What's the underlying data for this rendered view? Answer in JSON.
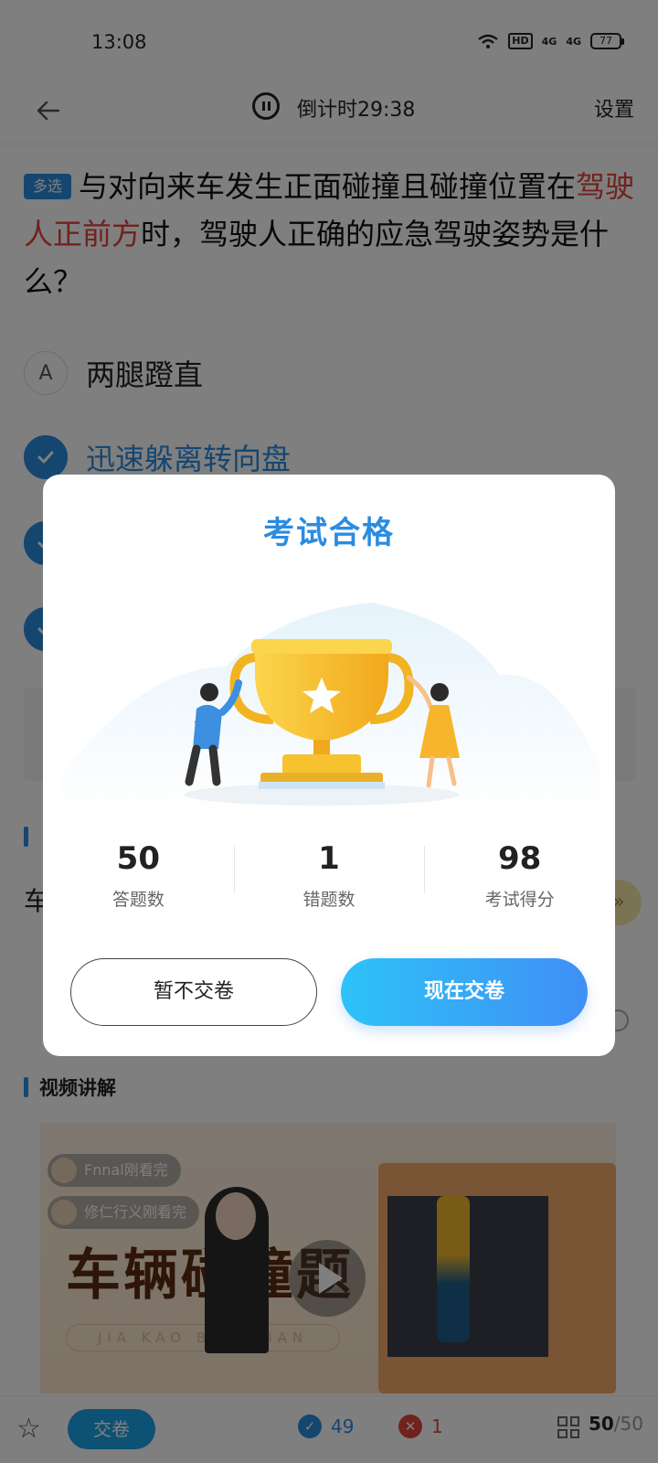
{
  "status_bar": {
    "time": "13:08",
    "network": "HD",
    "signal1": "4G",
    "signal2": "4G",
    "battery": "77"
  },
  "nav": {
    "countdown": "倒计时29:38",
    "settings": "设置"
  },
  "question": {
    "tag": "多选",
    "text_before": "与对向来车发生正面碰撞且碰撞位置在",
    "text_highlight": "驾驶人正前方",
    "text_after": "时，驾驶人正确的应急驾驶姿势是什么？"
  },
  "options": [
    {
      "letter": "A",
      "text": "两腿蹬直",
      "state": "unselected"
    },
    {
      "letter": "",
      "text": "迅速躲离转向盘",
      "state": "checked"
    }
  ],
  "partial_text": {
    "car": "车"
  },
  "video_section": {
    "title": "视频讲解",
    "viewers": [
      "Fnnal刚看完",
      "修仁行义刚看完"
    ],
    "video_title": "车辆碰撞题",
    "video_subtitle": "JIA KAO BAO DIAN"
  },
  "bottom_bar": {
    "submit": "交卷",
    "correct_count": "49",
    "wrong_count": "1",
    "progress_current": "50",
    "progress_total": "/50"
  },
  "dialog": {
    "title": "考试合格",
    "stats": [
      {
        "value": "50",
        "label": "答题数"
      },
      {
        "value": "1",
        "label": "错题数"
      },
      {
        "value": "98",
        "label": "考试得分"
      }
    ],
    "btn_later": "暂不交卷",
    "btn_now": "现在交卷"
  },
  "colors": {
    "accent": "#2b8ce0",
    "danger": "#e2453a",
    "trophy": "#f7c22f",
    "overlay": "rgba(0,0,0,0.5)"
  }
}
